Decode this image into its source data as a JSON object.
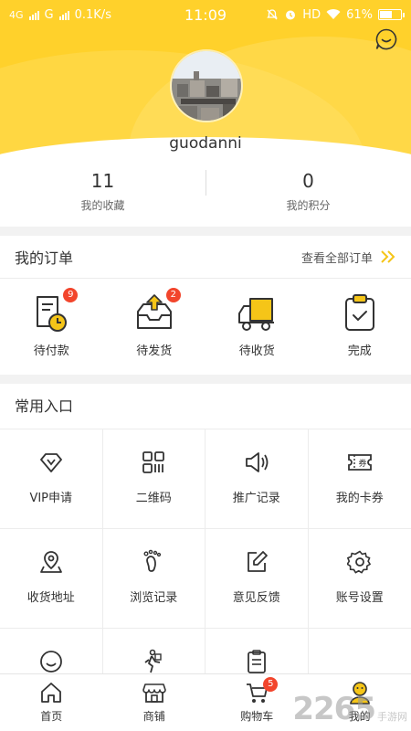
{
  "status_bar": {
    "network1": "4G",
    "network2": "G",
    "speed": "0.1K/s",
    "time": "11:09",
    "hd": "HD",
    "battery_text": "61%",
    "battery_level": 0.61
  },
  "profile": {
    "username": "guodanni"
  },
  "stats": [
    {
      "value": "11",
      "label": "我的收藏"
    },
    {
      "value": "0",
      "label": "我的积分"
    }
  ],
  "orders": {
    "title": "我的订单",
    "view_all": "查看全部订单",
    "items": [
      {
        "label": "待付款",
        "badge": "9",
        "icon": "pending-payment-icon"
      },
      {
        "label": "待发货",
        "badge": "2",
        "icon": "pending-shipment-icon"
      },
      {
        "label": "待收货",
        "badge": "",
        "icon": "delivery-truck-icon"
      },
      {
        "label": "完成",
        "badge": "",
        "icon": "completed-icon"
      }
    ]
  },
  "entries": {
    "title": "常用入口",
    "items": [
      {
        "label": "VIP申请",
        "icon": "diamond-icon"
      },
      {
        "label": "二维码",
        "icon": "qr-code-icon"
      },
      {
        "label": "推广记录",
        "icon": "speaker-icon"
      },
      {
        "label": "我的卡券",
        "icon": "coupon-icon"
      },
      {
        "label": "收货地址",
        "icon": "location-icon"
      },
      {
        "label": "浏览记录",
        "icon": "footprint-icon"
      },
      {
        "label": "意见反馈",
        "icon": "edit-icon"
      },
      {
        "label": "账号设置",
        "icon": "gear-icon"
      },
      {
        "label": "",
        "icon": "smile-icon"
      },
      {
        "label": "",
        "icon": "person-walking-icon"
      },
      {
        "label": "",
        "icon": "clipboard-icon"
      },
      {
        "label": "",
        "icon": ""
      }
    ]
  },
  "tabbar": {
    "items": [
      {
        "label": "首页",
        "icon": "home-icon",
        "badge": ""
      },
      {
        "label": "商铺",
        "icon": "shop-icon",
        "badge": ""
      },
      {
        "label": "购物车",
        "icon": "cart-icon",
        "badge": "5"
      },
      {
        "label": "我的",
        "icon": "profile-icon",
        "badge": ""
      }
    ]
  },
  "watermark": {
    "number": "2265",
    "sub": "手游网"
  },
  "colors": {
    "brand_yellow": "#ffd12b",
    "badge_red": "#f2452c",
    "accent_gold": "#f5c518"
  }
}
